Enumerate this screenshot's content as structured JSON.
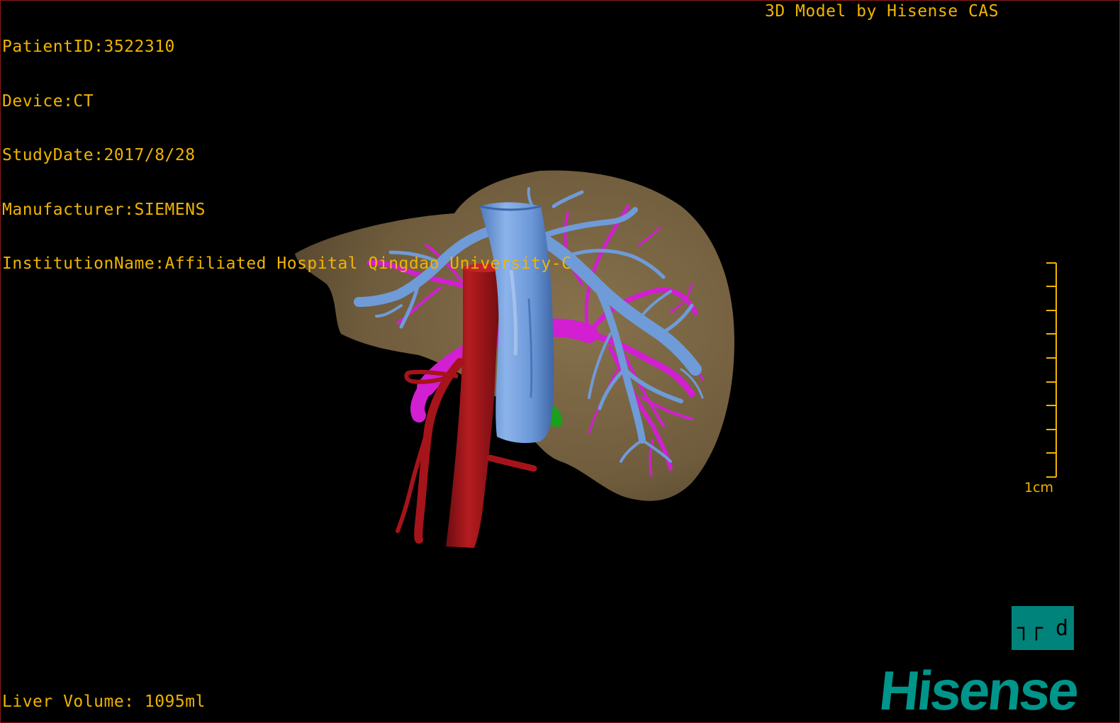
{
  "overlay": {
    "patient_id": "PatientID:3522310",
    "device": "Device:CT",
    "study_date": "StudyDate:2017/8/28",
    "manufacturer": "Manufacturer:SIEMENS",
    "institution": "InstitutionName:Affiliated Hospital Qingdao University-C",
    "credit": "3D Model by Hisense CAS",
    "liver_volume": "Liver Volume: 1095ml"
  },
  "scale_bar": {
    "label": "1cm"
  },
  "projection_button": {
    "label": "┐┌ d",
    "icon": "projection-toggle-icon"
  },
  "brand": {
    "logo_text": "Hisense"
  },
  "colors": {
    "overlay_text": "#f0b400",
    "liver": "#7a6647",
    "hepatic_vein": "#6f9bd8",
    "portal_vein": "#d11fd1",
    "artery": "#a5141a",
    "gallbladder": "#1aa01a",
    "brand": "#00958a",
    "viewport_border": "#8b1a1a"
  }
}
